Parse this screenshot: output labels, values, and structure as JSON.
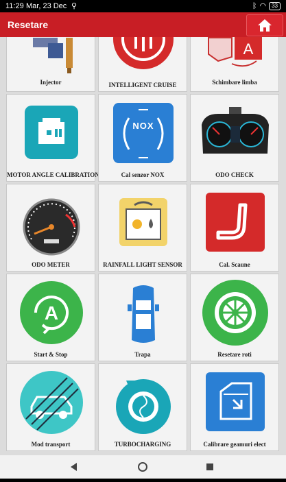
{
  "status_bar": {
    "time": "11:29",
    "date": "Mar, 23 Dec",
    "battery": "33"
  },
  "appbar": {
    "title": "Resetare"
  },
  "tiles": [
    {
      "label": "Injector",
      "icon": "injector-icon"
    },
    {
      "label": "INTELLIGENT CRUISE",
      "icon": "intelligent-cruise-icon"
    },
    {
      "label": "Schimbare limba",
      "icon": "language-change-icon"
    },
    {
      "label": "MOTOR ANGLE CALIBRATION",
      "icon": "motor-angle-calibration-icon"
    },
    {
      "label": "Cal senzor NOX",
      "icon": "nox-sensor-icon",
      "icon_text": "NOX"
    },
    {
      "label": "ODO CHECK",
      "icon": "instrument-cluster-icon"
    },
    {
      "label": "ODO METER",
      "icon": "odometer-gauge-icon"
    },
    {
      "label": "RAINFALL LIGHT SENSOR",
      "icon": "rainfall-light-sensor-icon"
    },
    {
      "label": "Cal. Scaune",
      "icon": "seat-calibration-icon"
    },
    {
      "label": "Start & Stop",
      "icon": "start-stop-icon",
      "icon_text": "A"
    },
    {
      "label": "Trapa",
      "icon": "sunroof-car-icon"
    },
    {
      "label": "Resetare roti",
      "icon": "wheel-reset-icon"
    },
    {
      "label": "Mod transport",
      "icon": "transport-mode-icon"
    },
    {
      "label": "TURBOCHARGING",
      "icon": "turbocharger-icon"
    },
    {
      "label": "Calibrare geamuri elect",
      "icon": "window-calibration-icon"
    }
  ],
  "colors": {
    "appbar": "#c81e25",
    "teal": "#1aa6b7",
    "green": "#3cb44a",
    "blue": "#2a7fd4",
    "red": "#d42a2a"
  }
}
